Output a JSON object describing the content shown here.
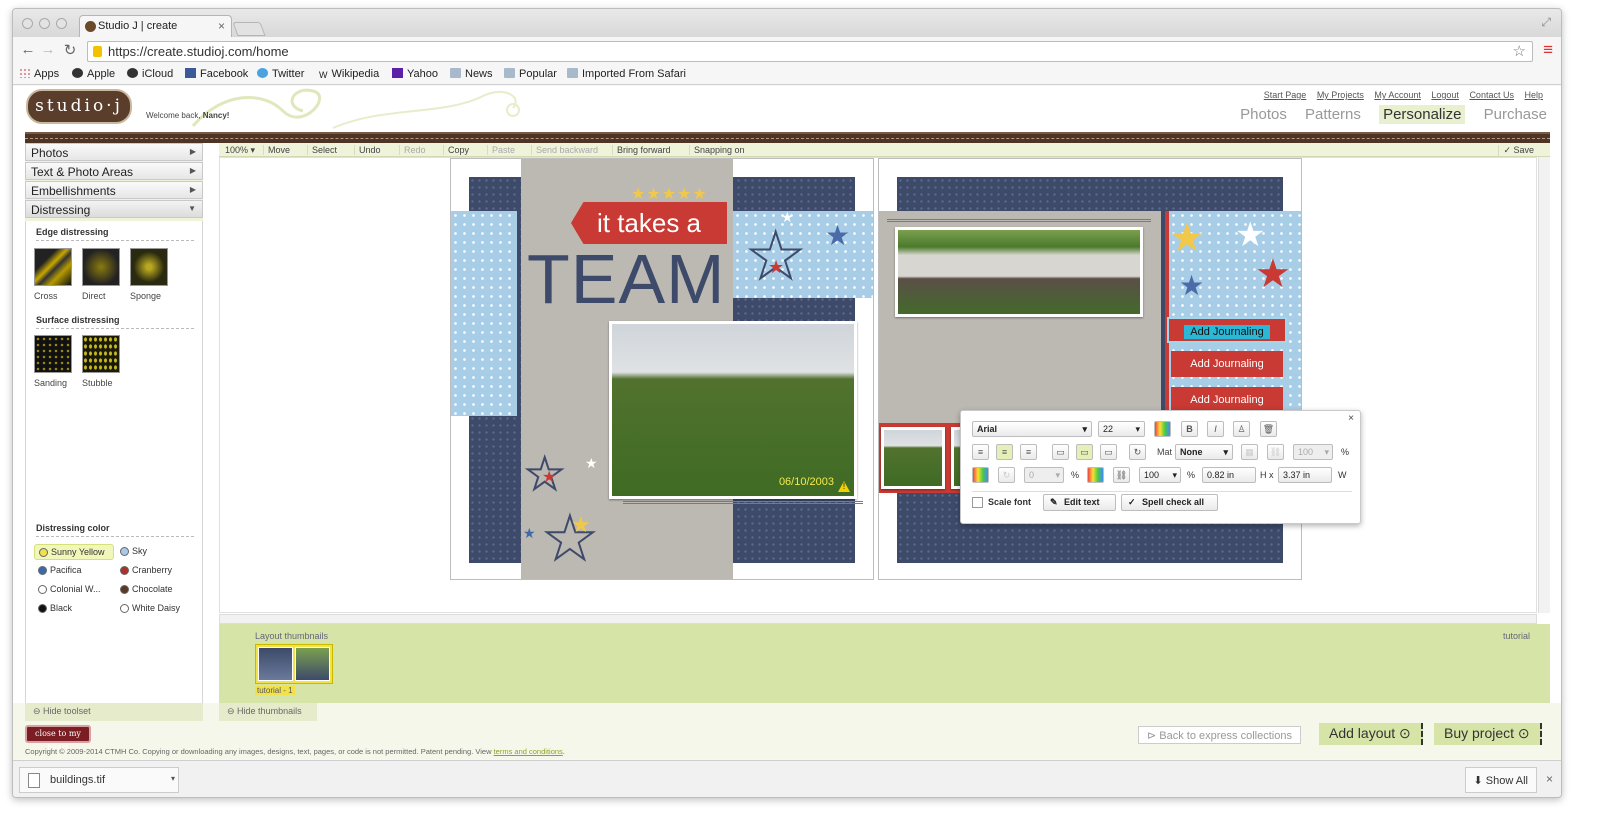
{
  "browser": {
    "tab_title": "Studio J | create",
    "url": "https://create.studioj.com/home",
    "bookmarks": [
      "Apps",
      "Apple",
      "iCloud",
      "Facebook",
      "Twitter",
      "Wikipedia",
      "Yahoo",
      "News",
      "Popular",
      "Imported From Safari"
    ]
  },
  "site": {
    "logo": "studio·j",
    "welcome_prefix": "Welcome back,",
    "welcome_name": "Nancy!",
    "top_links": [
      "Start Page",
      "My Projects",
      "My Account",
      "Logout",
      "Contact Us",
      "Help"
    ],
    "main_nav": [
      "Photos",
      "Patterns",
      "Personalize",
      "Purchase"
    ],
    "active_nav": "Personalize"
  },
  "left_panel": {
    "accordion": [
      "Photos",
      "Text & Photo Areas",
      "Embellishments",
      "Distressing"
    ],
    "edge_heading": "Edge distressing",
    "edge_items": [
      "Cross",
      "Direct",
      "Sponge"
    ],
    "surface_heading": "Surface distressing",
    "surface_items": [
      "Sanding",
      "Stubble"
    ],
    "color_heading": "Distressing color",
    "colors": [
      {
        "name": "Sunny Yellow",
        "hex": "#f2e24a",
        "selected": true
      },
      {
        "name": "Sky",
        "hex": "#a8c8e8"
      },
      {
        "name": "Pacifica",
        "hex": "#3a6aa8"
      },
      {
        "name": "Cranberry",
        "hex": "#a8322e"
      },
      {
        "name": "Colonial W...",
        "hex": "#ffffff"
      },
      {
        "name": "Chocolate",
        "hex": "#5a3a24"
      },
      {
        "name": "Black",
        "hex": "#111111"
      },
      {
        "name": "White Daisy",
        "hex": "#ffffff"
      }
    ],
    "hide_toolset": "Hide toolset"
  },
  "toolbar": {
    "zoom": "100%",
    "items": [
      "Move",
      "Select",
      "Undo",
      "Redo",
      "Copy",
      "Paste",
      "Send backward",
      "Bring forward",
      "Snapping on"
    ],
    "save": "Save"
  },
  "page_left": {
    "banner_text": "it takes a",
    "big_text": "TEAM",
    "date": "06/10/2003"
  },
  "page_right": {
    "journal_boxes": [
      "Add Journaling",
      "Add Journaling",
      "Add Journaling"
    ]
  },
  "text_tools": {
    "font": "Arial",
    "size": "22",
    "mat_label": "Mat",
    "mat_value": "None",
    "mat_opacity": "100",
    "opacity": "0",
    "pct": "%",
    "scale": "100",
    "height": "0.82 in",
    "h_label": "H",
    "x_label": "x",
    "width": "3.37 in",
    "w_label": "W",
    "scale_font": "Scale font",
    "edit_text": "Edit text",
    "spell_check": "Spell check all"
  },
  "thumbnails": {
    "heading": "Layout thumbnails",
    "right_label": "tutorial",
    "thumb_caption": "tutorial - 1",
    "hide_thumbnails": "Hide thumbnails"
  },
  "footer": {
    "brand": "close to my heart",
    "back": "Back to express collections",
    "add_layout": "Add layout",
    "buy_project": "Buy project",
    "copyright": "Copyright © 2009-2014 CTMH Co. Copying or downloading any images, designs, text, pages, or code is not permitted. Patent pending. View",
    "terms": "terms and conditions"
  },
  "downloads": {
    "file": "buildings.tif",
    "show_all": "Show All"
  }
}
